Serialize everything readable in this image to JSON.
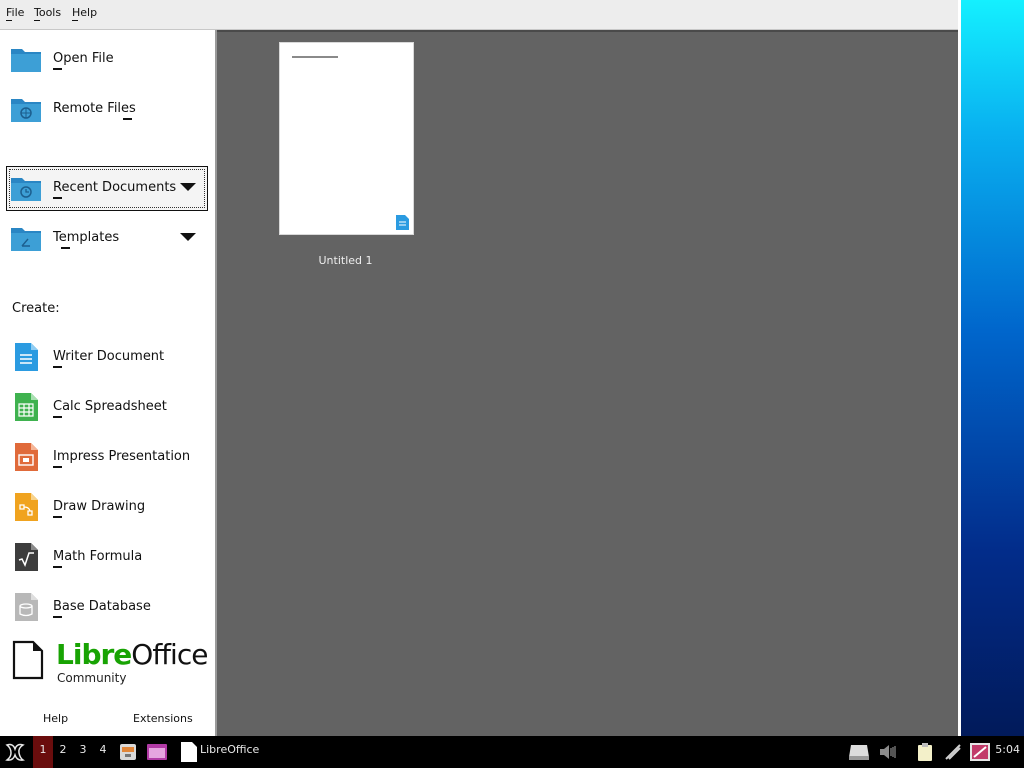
{
  "menu": [
    {
      "label": "File"
    },
    {
      "label": "Tools"
    },
    {
      "label": "Help"
    }
  ],
  "sidebar": {
    "open_file": "Open File",
    "remote_files": "Remote Files",
    "recent_documents": "Recent Documents",
    "templates": "Templates",
    "create_label": "Create:",
    "create_items": [
      {
        "label": "Writer Document",
        "icon": "writer-doc-icon",
        "color": "#2b9be1"
      },
      {
        "label": "Calc Spreadsheet",
        "icon": "calc-sheet-icon",
        "color": "#3fb24f"
      },
      {
        "label": "Impress Presentation",
        "icon": "impress-presentation-icon",
        "color": "#e06a3a"
      },
      {
        "label": "Draw Drawing",
        "icon": "draw-drawing-icon",
        "color": "#f0a31f"
      },
      {
        "label": "Math Formula",
        "icon": "math-formula-icon",
        "color": "#3d3d3d"
      },
      {
        "label": "Base Database",
        "icon": "base-database-icon",
        "color": "#b8b8b8"
      }
    ],
    "help_link": "Help",
    "extensions_link": "Extensions"
  },
  "logo": {
    "libre": "Libre",
    "office": "Office",
    "sub": "Community"
  },
  "recent": [
    {
      "title": "Untitled 1"
    }
  ],
  "taskbar": {
    "workspaces": [
      "1",
      "2",
      "3",
      "4"
    ],
    "active_workspace": "1",
    "window_label": "LibreOffice",
    "clock": "5:04"
  },
  "colors": {
    "folder": "#3d9fd6",
    "main_bg": "#636363",
    "logo_green": "#18a303"
  }
}
